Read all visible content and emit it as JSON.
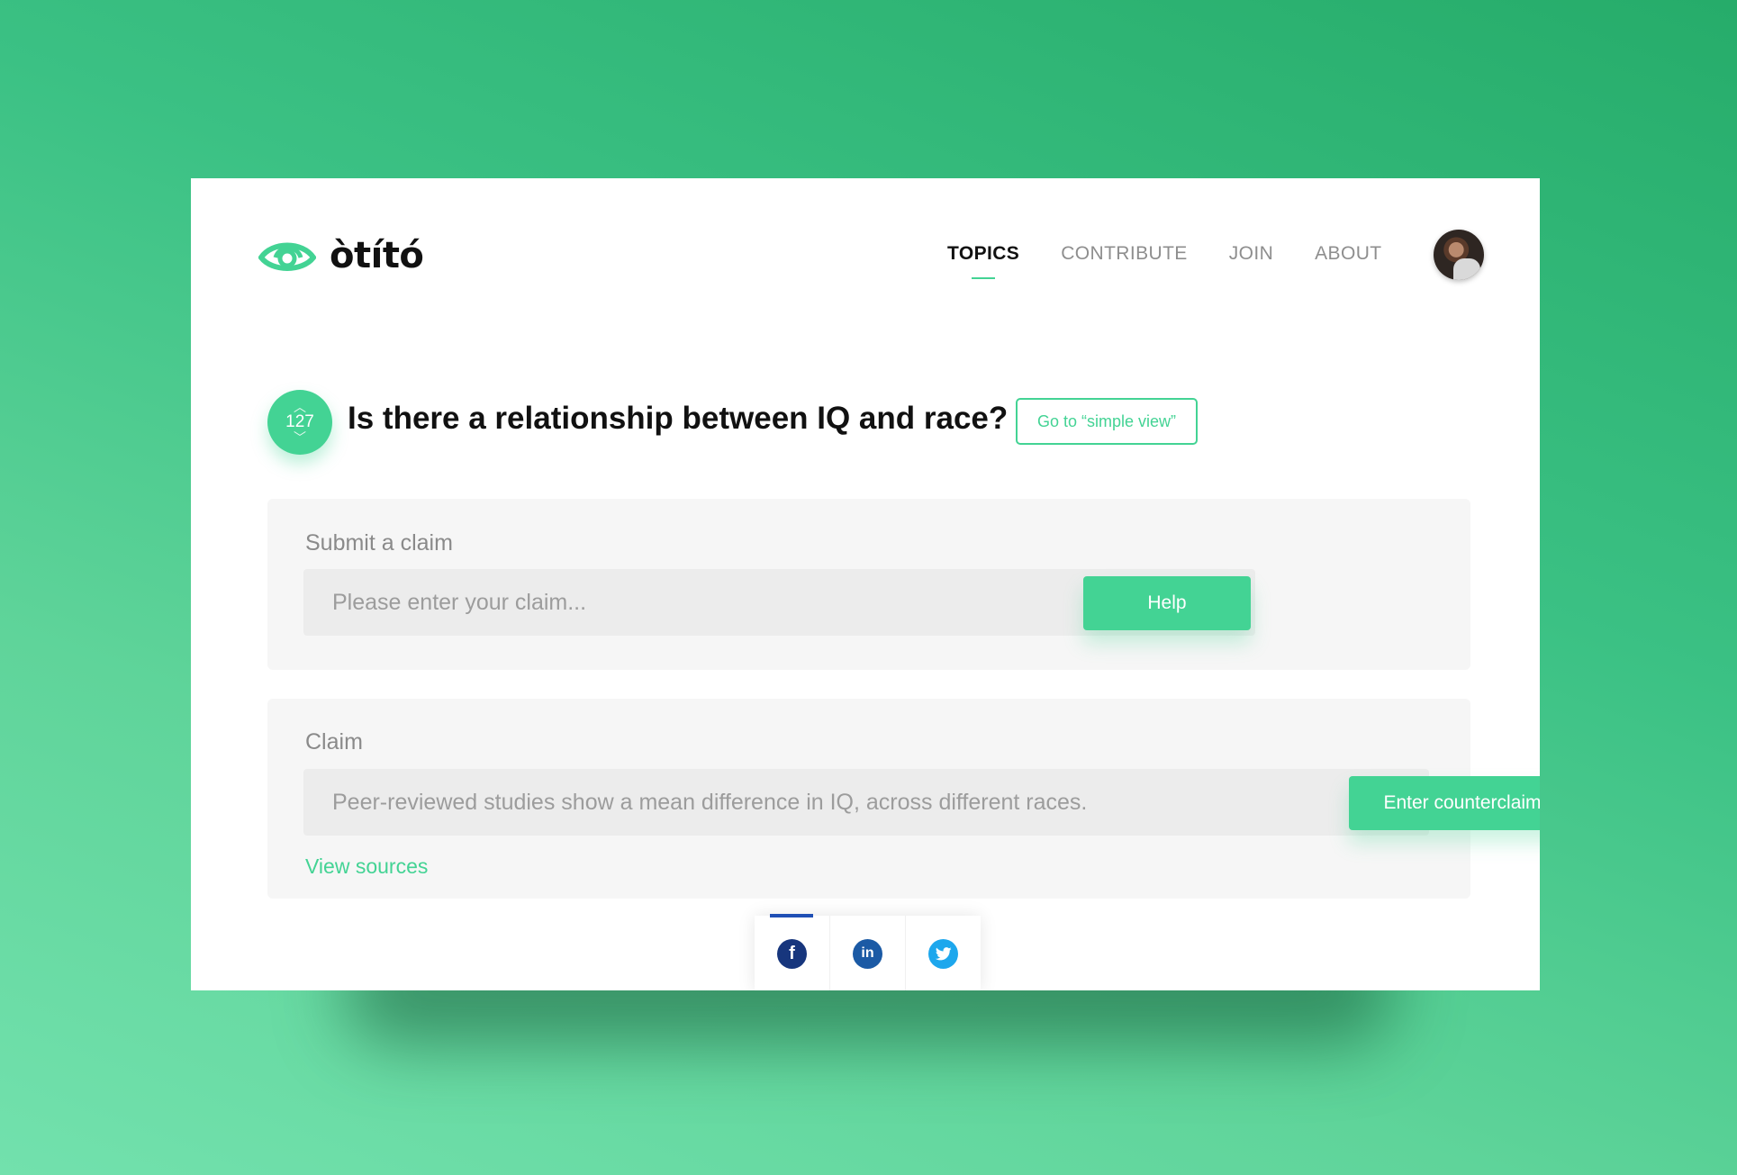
{
  "brand": {
    "name": "òtító",
    "accent_color": "#43d394"
  },
  "nav": {
    "items": [
      {
        "label": "TOPICS",
        "active": true
      },
      {
        "label": "CONTRIBUTE",
        "active": false
      },
      {
        "label": "JOIN",
        "active": false
      },
      {
        "label": "ABOUT",
        "active": false
      }
    ]
  },
  "user": {
    "avatar": "user-avatar-photo"
  },
  "topic": {
    "votes": "127",
    "up_icon": "chevron-up-icon",
    "down_icon": "chevron-down-icon",
    "question": "Is there a relationship between IQ and race?",
    "simple_view_label": "Go to “simple view”"
  },
  "submit_claim": {
    "label": "Submit a claim",
    "placeholder": "Please enter your claim...",
    "value": "",
    "help_label": "Help"
  },
  "claim": {
    "label": "Claim",
    "text": "Peer-reviewed studies show a mean difference in IQ, across different races.",
    "counterclaim_label": "Enter counterclaim",
    "sources_label": "View sources"
  },
  "share": {
    "items": [
      {
        "icon": "facebook-icon",
        "glyph": "f",
        "active": true,
        "color": "#17367d"
      },
      {
        "icon": "linkedin-icon",
        "glyph": "in",
        "active": false,
        "color": "#1b5aa5"
      },
      {
        "icon": "twitter-icon",
        "glyph": "",
        "active": false,
        "color": "#1da7ed"
      }
    ]
  }
}
